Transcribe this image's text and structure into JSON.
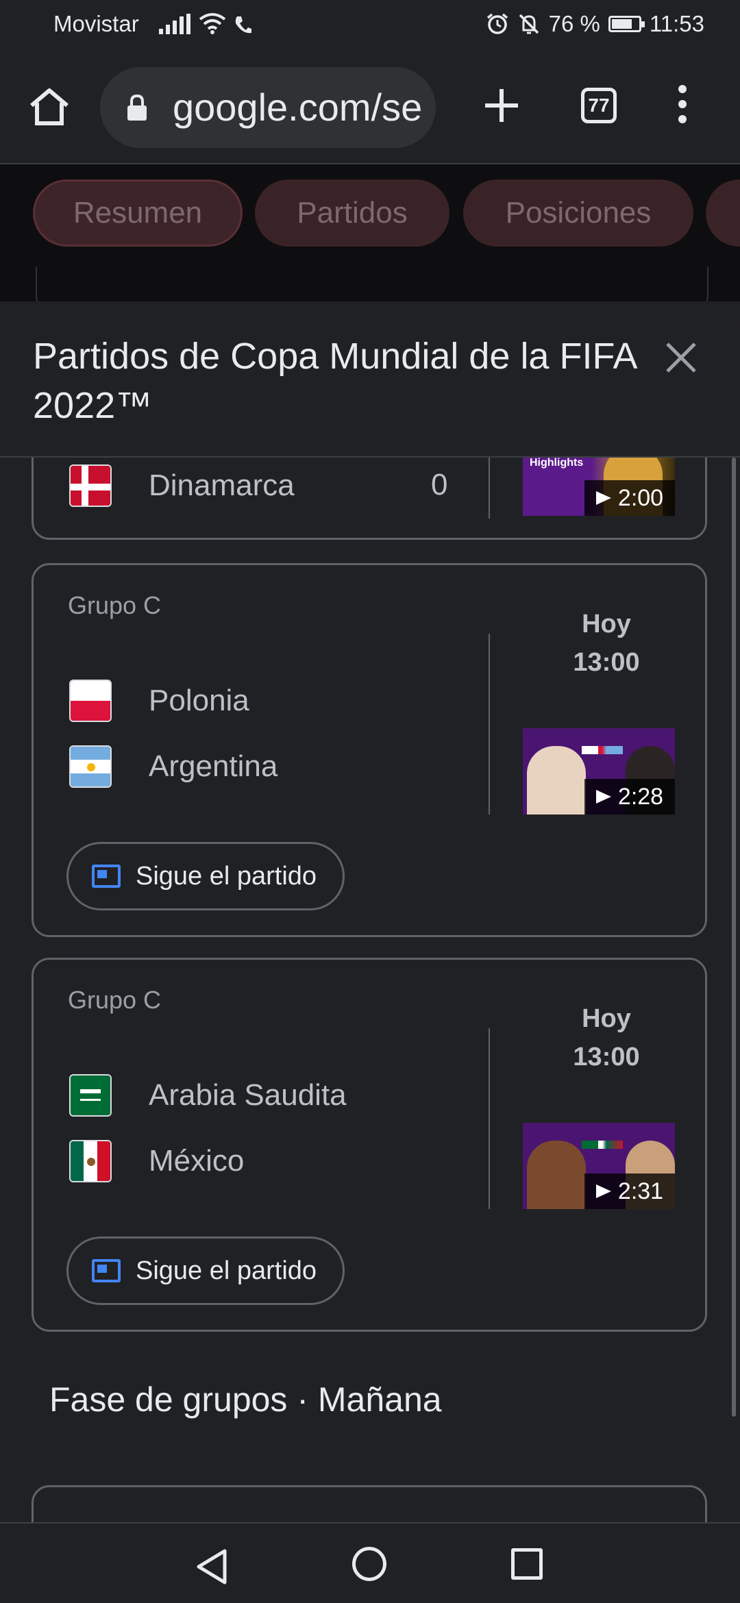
{
  "status_bar": {
    "carrier": "Movistar",
    "battery": "76 %",
    "battery_level": 0.76,
    "time": "11:53"
  },
  "browser": {
    "url": "google.com/se",
    "tab_count": "77"
  },
  "background_tabs": [
    "Resumen",
    "Partidos",
    "Posiciones"
  ],
  "sheet": {
    "title": "Partidos de Copa Mundial de la FIFA 2022™"
  },
  "matches": [
    {
      "team": "Dinamarca",
      "score": "0",
      "thumb_label": "Highlights",
      "duration": "2:00"
    },
    {
      "group": "Grupo C",
      "team1": "Polonia",
      "team2": "Argentina",
      "day": "Hoy",
      "time": "13:00",
      "duration": "2:28",
      "follow_label": "Sigue el partido"
    },
    {
      "group": "Grupo C",
      "team1": "Arabia Saudita",
      "team2": "México",
      "day": "Hoy",
      "time": "13:00",
      "duration": "2:31",
      "follow_label": "Sigue el partido"
    }
  ],
  "next_section": "Fase de grupos · Mañana",
  "colors": {
    "background": "#202124",
    "accent_blue": "#4285f4",
    "thumb_purple": "#4a1570"
  }
}
